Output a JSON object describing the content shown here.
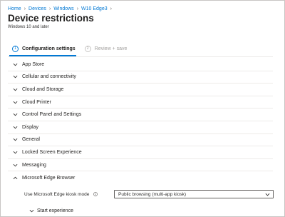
{
  "breadcrumb": [
    "Home",
    "Devices",
    "Windows",
    "W10 Edge3"
  ],
  "page": {
    "title": "Device restrictions",
    "subtitle": "Windows 10 and later"
  },
  "steps": [
    {
      "number": "1",
      "label": "Configuration settings",
      "state": "active"
    },
    {
      "number": "2",
      "label": "Review + save",
      "state": "inactive"
    }
  ],
  "sections": [
    {
      "label": "App Store",
      "expanded": false
    },
    {
      "label": "Cellular and connectivity",
      "expanded": false
    },
    {
      "label": "Cloud and Storage",
      "expanded": false
    },
    {
      "label": "Cloud Printer",
      "expanded": false
    },
    {
      "label": "Control Panel and Settings",
      "expanded": false
    },
    {
      "label": "Display",
      "expanded": false
    },
    {
      "label": "General",
      "expanded": false
    },
    {
      "label": "Locked Screen Experience",
      "expanded": false
    },
    {
      "label": "Messaging",
      "expanded": false
    },
    {
      "label": "Microsoft Edge Browser",
      "expanded": true
    }
  ],
  "edge_settings": {
    "kiosk_mode_label": "Use Microsoft Edge kiosk mode",
    "kiosk_mode_value": "Public browsing (multi-app kiosk)",
    "start_experience_label": "Start experience",
    "info_icon": "info-icon"
  },
  "colors": {
    "link": "#0078d4",
    "accent": "#0078d4",
    "text": "#201f1e",
    "muted": "#a19f9d",
    "divider": "#edebe9"
  }
}
